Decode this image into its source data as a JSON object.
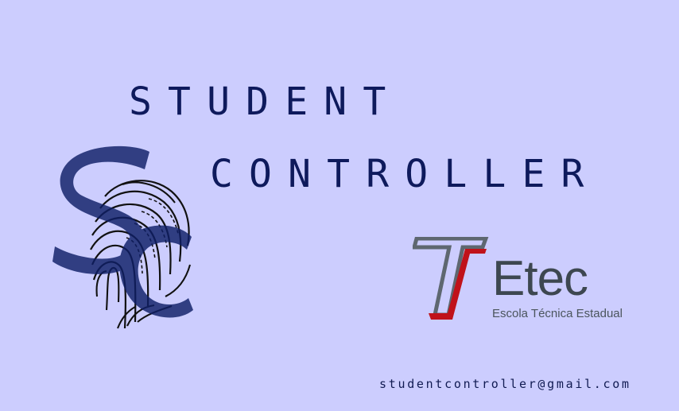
{
  "splash": {
    "title_line_1": "Student",
    "title_line_2": "Controller",
    "email": "studentcontroller@gmail.com",
    "brand_logo": {
      "letters": "SC",
      "icon": "fingerprint-icon"
    },
    "school_logo": {
      "name": "Etec",
      "subtitle": "Escola Técnica Estadual",
      "icon": "etec-t-icon"
    }
  },
  "colors": {
    "background": "#cccdfe",
    "title": "#0e1a5c",
    "brand_logo": "#0f1f67",
    "fingerprint": "#111111",
    "etec_text": "#3d4750",
    "etec_accent": "#c0121a"
  }
}
